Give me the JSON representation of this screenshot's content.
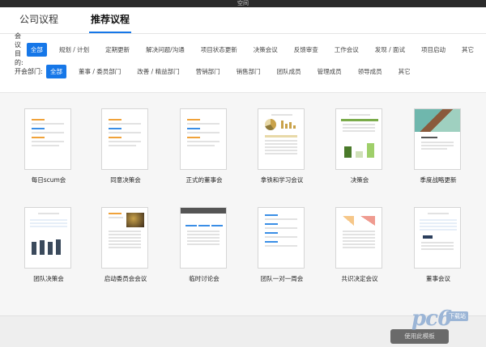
{
  "window": {
    "title": "空间"
  },
  "tabs": [
    {
      "label": "公司议程",
      "active": false
    },
    {
      "label": "推荐议程",
      "active": true
    }
  ],
  "filters": {
    "purpose": {
      "label": "会议目的:",
      "options": [
        "全部",
        "规划 / 计划",
        "定期更新",
        "解决问题/沟通",
        "项目状态更新",
        "决策会议",
        "反馈审查",
        "工作会议",
        "发现 / 面试",
        "项目启动",
        "其它"
      ],
      "selected": "全部"
    },
    "department": {
      "label": "开会部门:",
      "options": [
        "全部",
        "董事 / 委员部门",
        "改善 / 精益部门",
        "营销部门",
        "销售部门",
        "团队成员",
        "管理成员",
        "领导成员",
        "其它"
      ],
      "selected": "全部"
    }
  },
  "templates": [
    {
      "name": "每日scum会"
    },
    {
      "name": "同意决策会"
    },
    {
      "name": "正式的董事会"
    },
    {
      "name": "拿铁和学习会议"
    },
    {
      "name": "决策会"
    },
    {
      "name": "季度战略更新"
    },
    {
      "name": "团队决策会"
    },
    {
      "name": "启动委员会会议"
    },
    {
      "name": "临时讨论会"
    },
    {
      "name": "团队一对一周会"
    },
    {
      "name": "共识决定会议"
    },
    {
      "name": "董事会议"
    }
  ],
  "footer": {
    "use_button": "使用此模板"
  },
  "watermark": {
    "logo_text": "pc6",
    "sub_text": "下载站"
  },
  "colors": {
    "accent": "#1677e8",
    "orange": "#f0a23a",
    "blue": "#3a8ee6",
    "green": "#7aab4a",
    "teal": "#6fb7ad",
    "brown": "#8a5a3c"
  }
}
